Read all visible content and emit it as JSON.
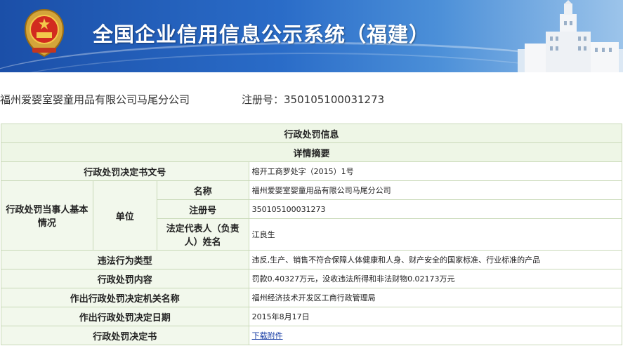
{
  "header": {
    "title": "全国企业信用信息公示系统（福建）",
    "emblem_icon": "national-emblem-icon",
    "building_icon": "building-icon",
    "colors": {
      "banner_start": "#1b4fa8",
      "banner_end": "#9cc4ea"
    }
  },
  "company": {
    "name": "福州爱婴室婴童用品有限公司马尾分公司",
    "reg_label": "注册号：",
    "reg_number": "350105100031273"
  },
  "table": {
    "section_title": "行政处罚信息",
    "subsection_title": "详情摘要",
    "doc_number_label": "行政处罚决定书文号",
    "doc_number_value": "榕开工商罗处字（2015）1号",
    "party_label": "行政处罚当事人基本情况",
    "unit_label": "单位",
    "name_label": "名称",
    "name_value": "福州爱婴室婴童用品有限公司马尾分公司",
    "reg_label": "注册号",
    "reg_value": "350105100031273",
    "rep_label": "法定代表人（负责人）姓名",
    "rep_value": "江良生",
    "violation_label": "违法行为类型",
    "violation_value": "违反,生产、销售不符合保障人体健康和人身、财产安全的国家标准、行业标准的产品",
    "content_label": "行政处罚内容",
    "content_value": "罚款0.40327万元，没收违法所得和非法财物0.02173万元",
    "authority_label": "作出行政处罚决定机关名称",
    "authority_value": "福州经济技术开发区工商行政管理局",
    "date_label": "作出行政处罚决定日期",
    "date_value": "2015年8月17日",
    "decision_label": "行政处罚决定书",
    "decision_link": "下载附件"
  }
}
